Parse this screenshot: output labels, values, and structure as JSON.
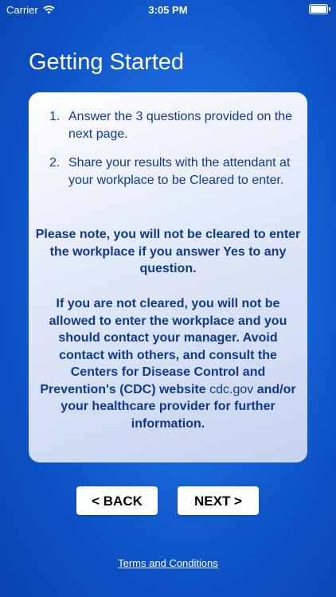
{
  "status_bar": {
    "carrier": "Carrier",
    "time": "3:05 PM",
    "wifi_icon": "wifi-icon",
    "battery_icon": "battery-icon"
  },
  "page": {
    "title": "Getting Started"
  },
  "instructions": {
    "steps": [
      {
        "number": "1.",
        "text": "Answer the 3 questions provided on the next page."
      },
      {
        "number": "2.",
        "text": "Share your results with the attendant at your workplace to be Cleared to enter."
      }
    ],
    "note1": "Please note, you will not be cleared to enter the workplace if you answer Yes to any question.",
    "note2_before": "If you are not cleared, you will not be allowed to enter the workplace and you should contact your manager. Avoid contact with others, and consult the Centers for Disease Control and Prevention's (CDC) website",
    "note2_link": "cdc.gov",
    "note2_after": "and/or your healthcare provider for further information."
  },
  "navigation": {
    "back_label": "< BACK",
    "next_label": "NEXT >"
  },
  "footer": {
    "terms_label": "Terms and Conditions"
  },
  "colors": {
    "background": "#1a69de",
    "card_text": "#0f3a8c",
    "button_bg": "#ffffff"
  }
}
